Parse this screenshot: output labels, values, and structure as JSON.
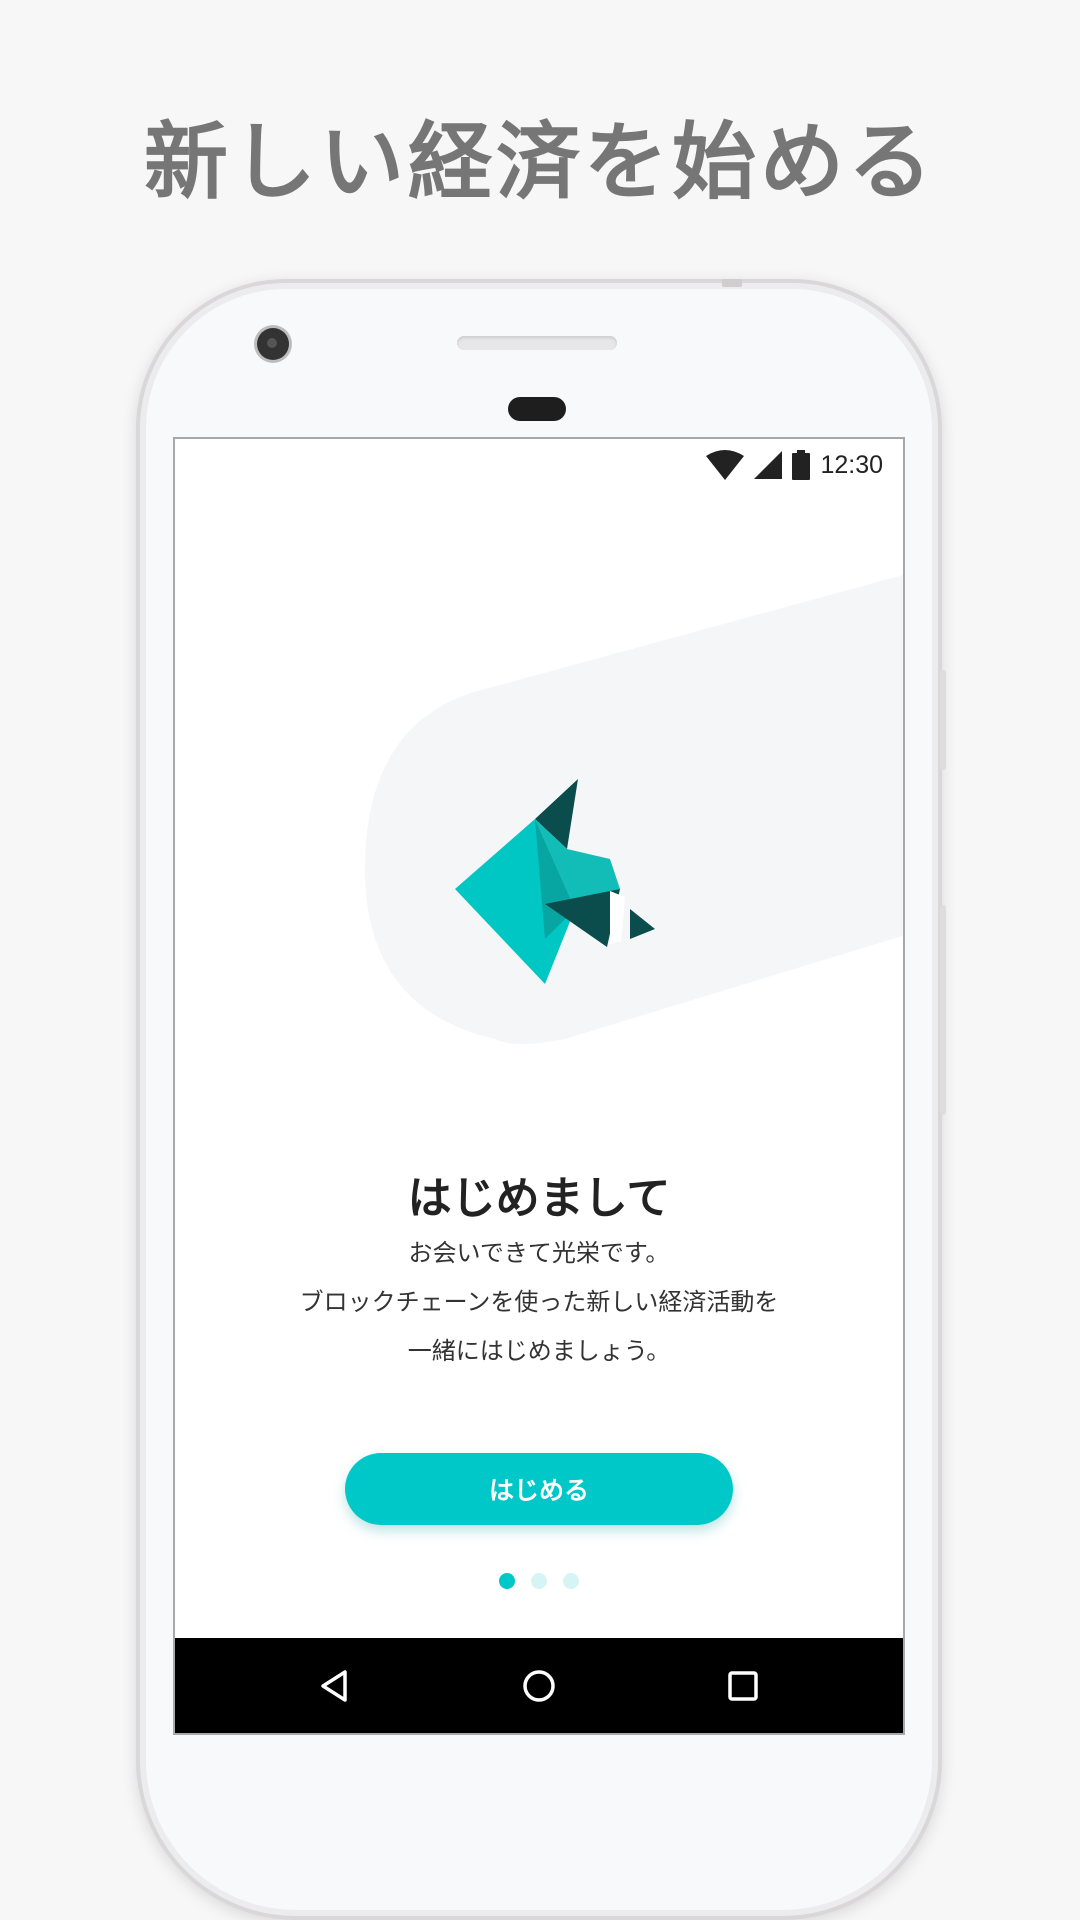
{
  "headline": "新しい経済を始める",
  "status_bar": {
    "time": "12:30",
    "icons": [
      "wifi-icon",
      "cell-signal-icon",
      "battery-icon"
    ]
  },
  "onboarding": {
    "illustration": "origami-bird-icon",
    "title": "はじめまして",
    "description_lines": [
      "お会いできて光栄です。",
      "ブロックチェーンを使った新しい経済活動を",
      "一緒にはじめましょう。"
    ],
    "start_button_label": "はじめる",
    "page_indicator": {
      "total": 3,
      "current": 1
    }
  },
  "nav_bar": {
    "buttons": [
      "back-icon",
      "home-icon",
      "recents-icon"
    ]
  },
  "colors": {
    "accent": "#00c8c8",
    "accent_dark": "#004d4d",
    "headline_gray": "#767676",
    "indicator_inactive": "#d6f4f4"
  }
}
